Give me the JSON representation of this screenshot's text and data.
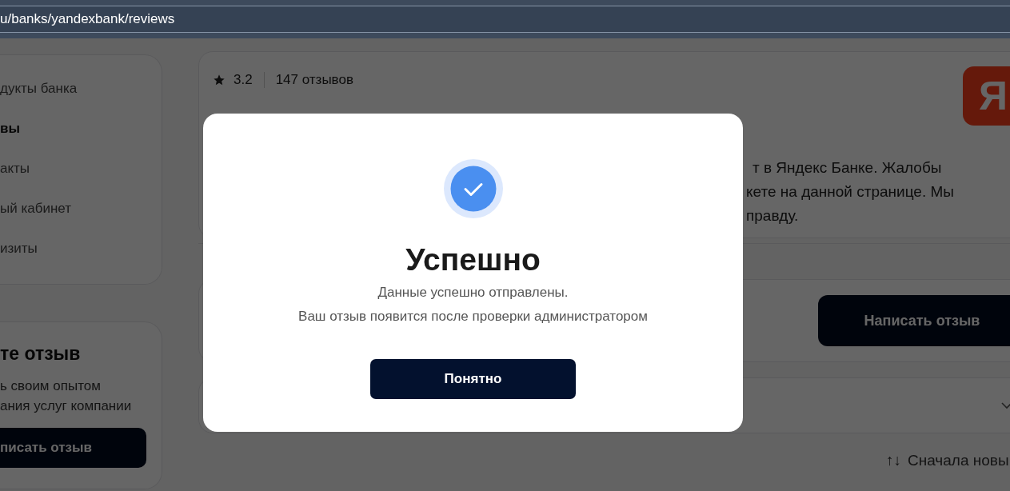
{
  "address_bar": {
    "url": "u/banks/yandexbank/reviews"
  },
  "sidebar": {
    "menu": [
      {
        "label": "дукты банка",
        "selected": false
      },
      {
        "label": "вы",
        "selected": true
      },
      {
        "label": "акты",
        "selected": false
      },
      {
        "label": "ый кабинет",
        "selected": false
      },
      {
        "label": "изиты",
        "selected": false
      }
    ],
    "review_card": {
      "title": "те отзыв",
      "text_lines": [
        "ь своим опытом",
        "ания услуг компании"
      ],
      "button": "писать отзыв"
    }
  },
  "bank_card": {
    "rating": "3.2",
    "reviews_count": "147 отзывов",
    "logo": "Я",
    "description_lines": [
      "т в Яндекс Банке. Жалобы",
      "кете на данной странице. Мы",
      "правду."
    ]
  },
  "write_review": {
    "button": "Написать отзыв"
  },
  "sort": {
    "icon": "↑↓",
    "label": "Сначала новы"
  },
  "modal": {
    "title": "Успешно",
    "message_lines": [
      "Данные успешно отправлены.",
      "Ваш отзыв появится после проверки администратором"
    ],
    "button": "Понятно"
  }
}
